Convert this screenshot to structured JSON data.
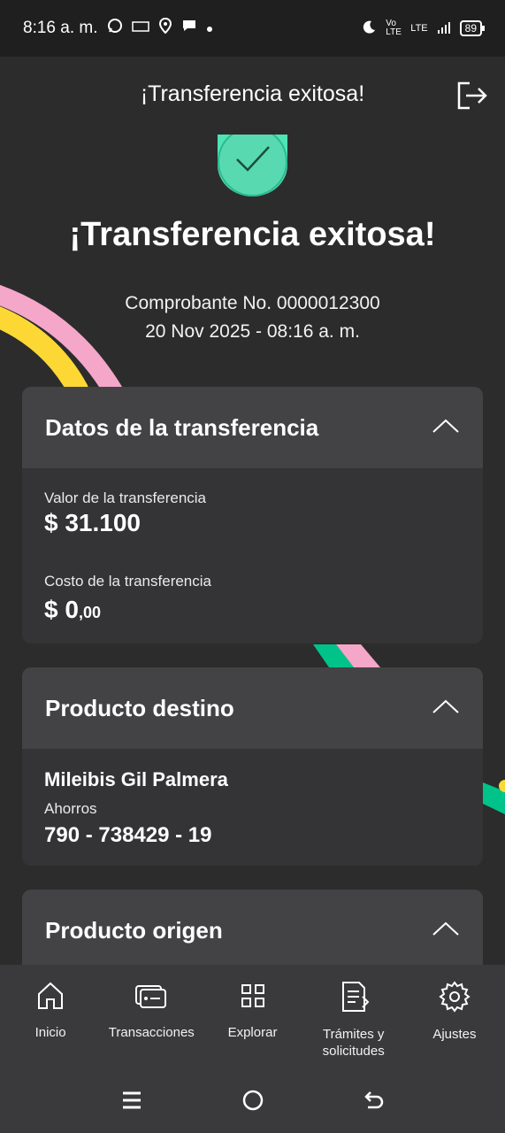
{
  "status_bar": {
    "time": "8:16 a. m.",
    "network_label": "Vo LTE",
    "lte_label": "LTE",
    "battery": "89"
  },
  "header": {
    "title": "¡Transferencia exitosa!"
  },
  "success": {
    "title": "¡Transferencia exitosa!",
    "receipt_line": "Comprobante No. 0000012300",
    "datetime_line": "20 Nov 2025 - 08:16 a. m."
  },
  "transfer_card": {
    "title": "Datos de la transferencia",
    "value_label": "Valor de la transferencia",
    "value": "$ 31.100",
    "cost_label": "Costo de la transferencia",
    "cost_main": "$ 0",
    "cost_cents": ",00"
  },
  "destination_card": {
    "title": "Producto destino",
    "name": "Mileibis Gil Palmera",
    "account_type": "Ahorros",
    "account_number": "790 - 738429 - 19"
  },
  "origin_card": {
    "title": "Producto origen"
  },
  "bottom_nav": {
    "items": [
      {
        "label": "Inicio",
        "icon": "home-icon"
      },
      {
        "label": "Transacciones",
        "icon": "transactions-icon"
      },
      {
        "label": "Explorar",
        "icon": "grid-icon"
      },
      {
        "label": "Trámites y solicitudes",
        "icon": "document-icon"
      },
      {
        "label": "Ajustes",
        "icon": "gear-icon"
      }
    ]
  },
  "colors": {
    "background": "#2c2c2c",
    "card": "#343436",
    "card_header": "#434345",
    "success_green": "#58d9b0",
    "deco_pink": "#f4a7c9",
    "deco_yellow": "#fdd835",
    "deco_green": "#00c389"
  }
}
